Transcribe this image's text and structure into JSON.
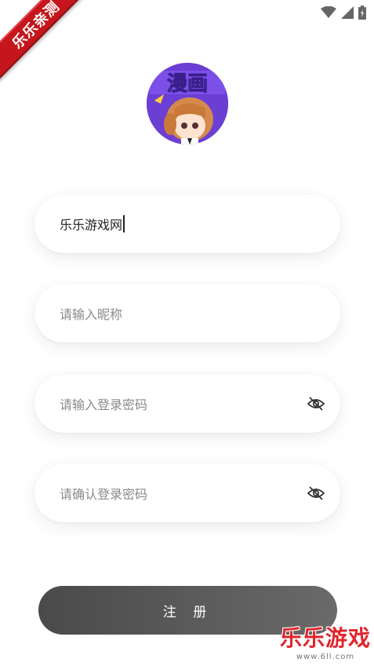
{
  "watermark_ribbon": {
    "text": "乐乐亲测"
  },
  "status_bar": {
    "icons": [
      "wifi-icon",
      "signal-icon",
      "battery-charging-icon"
    ]
  },
  "form": {
    "username": {
      "value": "乐乐游戏网"
    },
    "nickname": {
      "placeholder": "请输入昵称"
    },
    "password": {
      "placeholder": "请输入登录密码",
      "icon": "eye-off-icon"
    },
    "confirm_password": {
      "placeholder": "请确认登录密码",
      "icon": "eye-off-icon"
    }
  },
  "register_button": {
    "label": "注 册"
  },
  "watermark_corner": {
    "title": "乐乐游戏",
    "url": "www.6ll.com"
  },
  "avatar": {
    "caption": "漫画"
  },
  "colors": {
    "button_bg": "#555555",
    "ribbon": "#c4161c",
    "avatar_bg": "#6b3fd4"
  }
}
